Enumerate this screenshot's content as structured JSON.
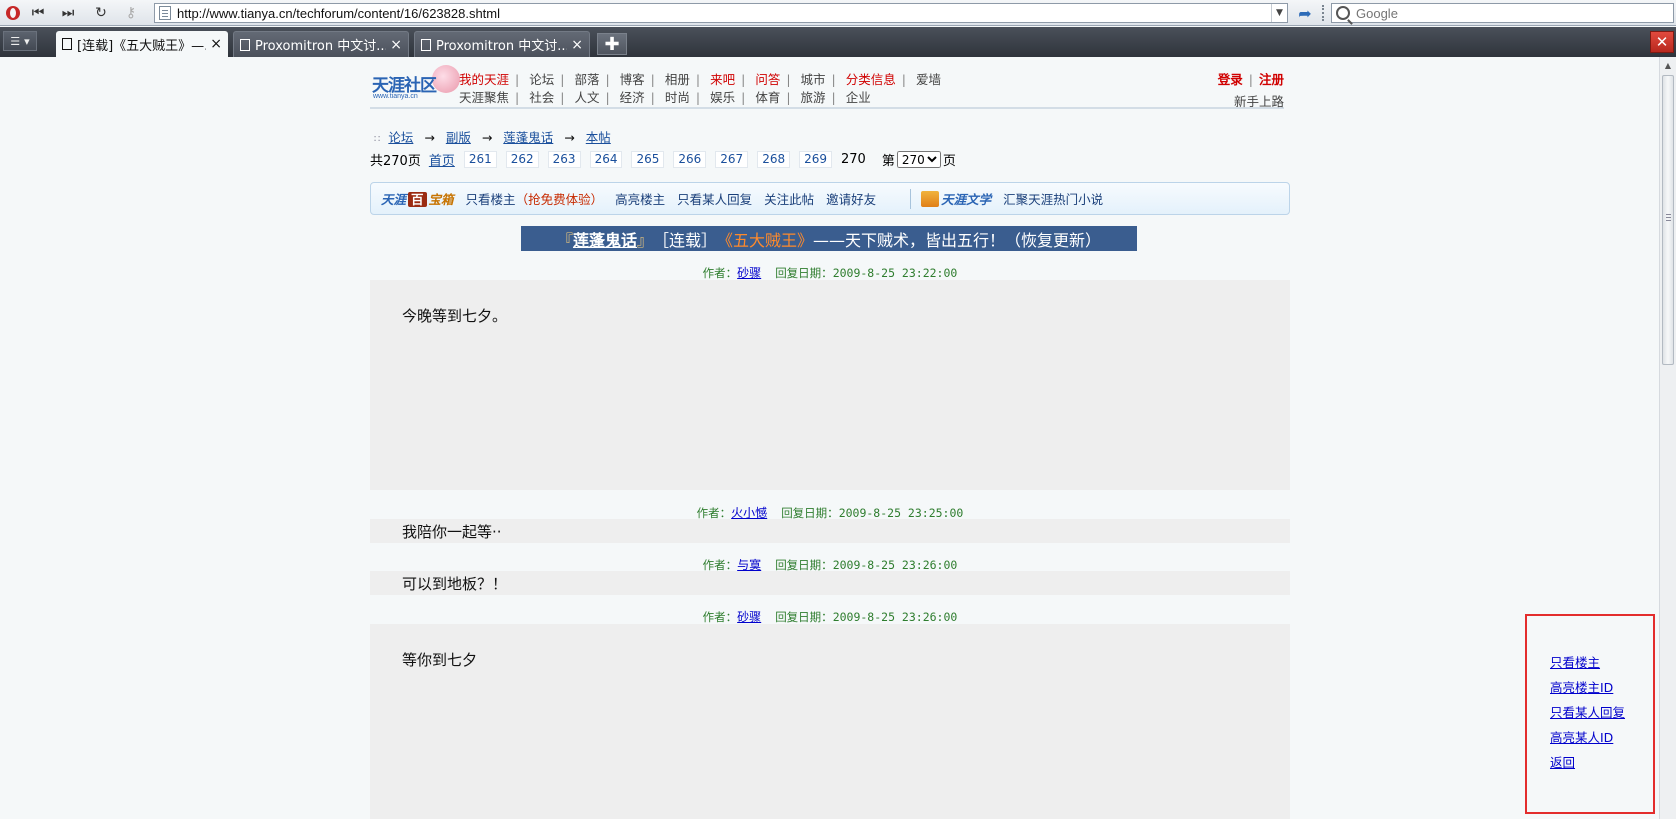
{
  "browser": {
    "url": "http://www.tianya.cn/techforum/content/16/623828.shtml",
    "search_placeholder": "Google",
    "tabs": [
      {
        "label": "[连载]《五大贼王》—…",
        "active": true
      },
      {
        "label": "Proxomitron 中文讨......",
        "active": false
      },
      {
        "label": "Proxomitron 中文讨......",
        "active": false
      }
    ]
  },
  "header": {
    "logo_text": "天涯社区",
    "logo_sub": "www.tianya.cn",
    "nav_row1": [
      "我的天涯",
      "论坛",
      "部落",
      "博客",
      "相册",
      "来吧",
      "问答",
      "城市",
      "分类信息",
      "爱墙"
    ],
    "nav_row2": [
      "天涯聚焦",
      "社会",
      "人文",
      "经济",
      "时尚",
      "娱乐",
      "体育",
      "旅游",
      "企业"
    ],
    "login": "登录",
    "register": "注册",
    "newbie": "新手上路"
  },
  "breadcrumb": {
    "items": [
      "论坛",
      "副版",
      "莲蓬鬼话",
      "本帖"
    ],
    "arrow": "→"
  },
  "pager": {
    "total_prefix": "共270页",
    "first": "首页",
    "pages": [
      "261",
      "262",
      "263",
      "264",
      "265",
      "266",
      "267",
      "268",
      "269"
    ],
    "current": "270",
    "goto_prefix": "第",
    "goto_value": "270",
    "goto_suffix": "页"
  },
  "toolbox": {
    "brand_a": "天涯",
    "brand_b": "百",
    "brand_c": "宝箱",
    "links": {
      "only_op": "只看楼主",
      "only_op_promo": "（抢免费体验）",
      "highlight_op": "高亮楼主",
      "only_someone": "只看某人回复",
      "follow": "关注此帖",
      "invite": "邀请好友"
    },
    "lit_brand": "天涯文学",
    "lit_link": "汇聚天涯热门小说"
  },
  "thread_title": {
    "open_bracket": "『",
    "board": "莲蓬鬼话",
    "close_bracket": "』",
    "tag": "［连载］",
    "book": "《五大贼王》",
    "rest": "——天下贼术，皆出五行！（恢复更新）"
  },
  "labels": {
    "author": "作者：",
    "date": "回复日期："
  },
  "posts": [
    {
      "author": "砂骤",
      "date": "2009-8-25 23:22:00",
      "content": "今晚等到七夕。"
    },
    {
      "author": "火小憾",
      "date": "2009-8-25 23:25:00",
      "content": "我陪你一起等··"
    },
    {
      "author": "与寞",
      "date": "2009-8-25 23:26:00",
      "content": "可以到地板？！"
    },
    {
      "author": "砂骤",
      "date": "2009-8-25 23:26:00",
      "content": "等你到七夕"
    }
  ],
  "side_panel": {
    "links": [
      "只看楼主",
      "高亮楼主ID",
      "只看某人回复",
      "高亮某人ID",
      "返回"
    ],
    "border_color": "#e32d2d"
  },
  "colors": {
    "accent_red": "#d00000",
    "link_blue": "#1a4f9c",
    "title_bar": "#3a5d8f",
    "meta_green": "#2e7d2e"
  }
}
